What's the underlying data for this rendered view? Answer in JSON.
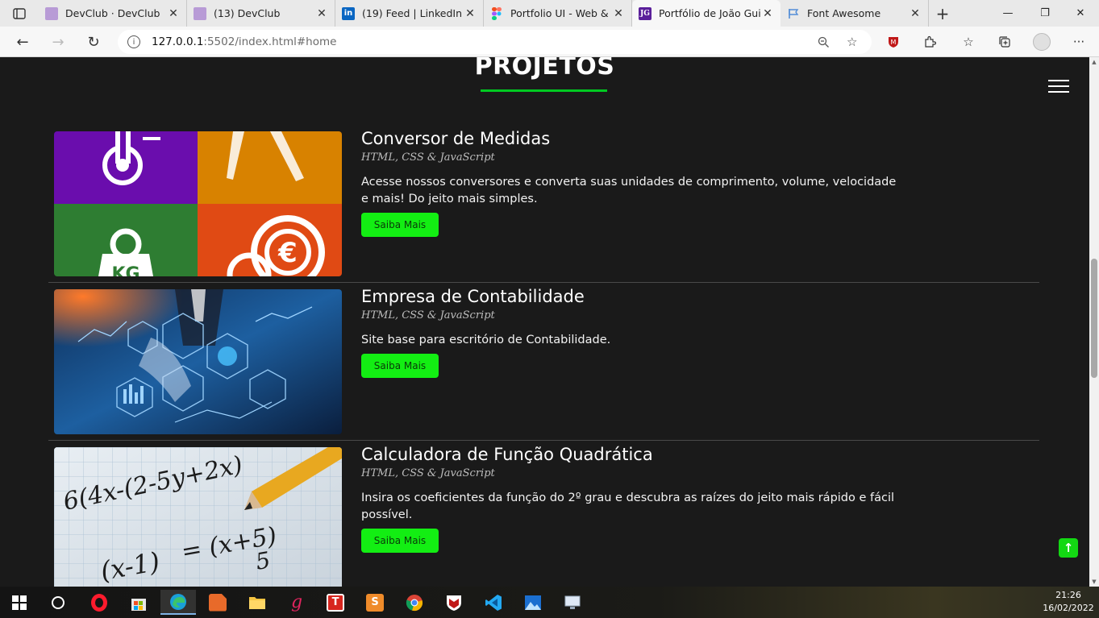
{
  "browser": {
    "tabs": [
      {
        "title": "DevClub · DevClub",
        "favicon": "devclub-favicon",
        "active": false
      },
      {
        "title": "(13) DevClub",
        "favicon": "devclub-favicon",
        "active": false
      },
      {
        "title": "(19) Feed | LinkedIn",
        "favicon": "linkedin-favicon",
        "active": false
      },
      {
        "title": "Portfolio UI - Web & M",
        "favicon": "figma-favicon",
        "active": false
      },
      {
        "title": "Portfólio de João Guil",
        "favicon": "jg-favicon",
        "active": true
      },
      {
        "title": "Font Awesome",
        "favicon": "font-awesome-flag-favicon",
        "active": false
      }
    ],
    "favicon_text": {
      "jg": "JG",
      "linkedin": "in"
    },
    "url_host": "127.0.0.1",
    "url_path": ":5502/index.html#home"
  },
  "page": {
    "section_title": "PROJETOS",
    "projects": [
      {
        "title": "Conversor de Medidas",
        "tech": "HTML, CSS & JavaScript",
        "description": "Acesse nossos conversores e converta suas unidades de comprimento, volume, velocidade e mais! Do jeito mais simples.",
        "button": "Saiba Mais"
      },
      {
        "title": "Empresa de Contabilidade",
        "tech": "HTML, CSS & JavaScript",
        "description": "Site base para escritório de Contabilidade.",
        "button": "Saiba Mais"
      },
      {
        "title": "Calculadora de Função Quadrática",
        "tech": "HTML, CSS & JavaScript",
        "description": "Insira os coeficientes da função do 2º grau e descubra as raízes do jeito mais rápido e fácil possível.",
        "button": "Saiba Mais"
      }
    ],
    "image_text": {
      "kg": "KG",
      "formula_1": "6(4x-(2-5y+2x)",
      "formula_2": "(x-1)",
      "formula_3": "= (x+5)",
      "formula_4": "5"
    }
  },
  "taskbar": {
    "time": "21:26",
    "date": "16/02/2022",
    "apps": [
      "windows-start",
      "cortana-search",
      "opera",
      "microsoft-store",
      "edge",
      "sublime-like-app",
      "file-explorer",
      "g-app",
      "todoist",
      "sublime-text",
      "chrome",
      "mcafee",
      "vscode",
      "photos",
      "display-settings"
    ]
  },
  "colors": {
    "accent_green": "#13ee13",
    "page_bg": "#1a1a1a",
    "underline_green": "#00c921"
  }
}
